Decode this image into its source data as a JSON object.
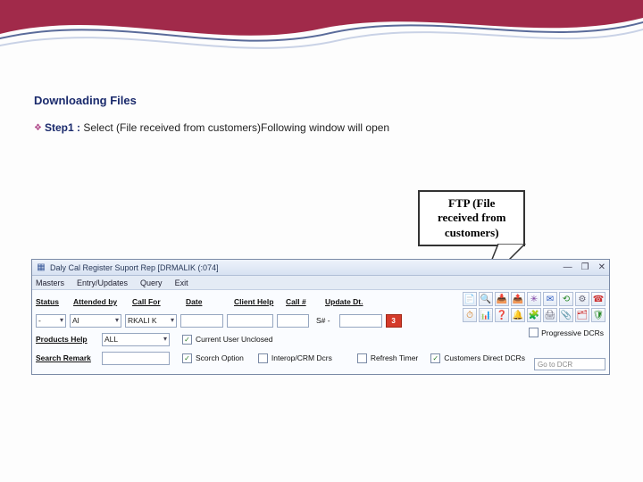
{
  "slide": {
    "title": "Downloading Files",
    "step_label": "Step1 :",
    "step_text": " Select (File received from customers)Following window will open"
  },
  "callout": {
    "line1": "FTP (File",
    "line2": "received from",
    "line3": "customers)"
  },
  "app": {
    "title": "Daly Cal Register  Suport Rep [DRMALIK (:074]",
    "menu": {
      "m1": "Masters",
      "m2": "Entry/Updates",
      "m3": "Query",
      "m4": "Exit"
    },
    "winbtns": {
      "min": "—",
      "max": "❐",
      "close": "✕"
    },
    "labels": {
      "status": "Status",
      "attended": "Attended by",
      "callfor": "Call For",
      "date": "Date",
      "clienthelp": "Client Help",
      "call": "Call #",
      "updatedt": "Update Dt.",
      "products": "Products Help",
      "search": "Search Remark"
    },
    "values": {
      "status_v": "-",
      "attended_v": "Al",
      "callfor_v": "RKALI K",
      "date_v": "",
      "call_v": "",
      "srno": "S# -",
      "products_v": "ALL"
    },
    "redbtn": "3",
    "checks": {
      "currentuser": "Current User Unclosed",
      "scrch": "Scorch Option",
      "interop": "Interop/CRM Dcrs",
      "refresh": "Refresh Timer",
      "custdirect": "Customers Direct DCRs",
      "progressive": "Progressive DCRs"
    },
    "goto_placeholder": "Go to DCR"
  },
  "icons": {
    "t1": "📄",
    "t2": "🔍",
    "t3": "📥",
    "t4": "📤",
    "t5": "✳",
    "t6": "✉",
    "t7": "⟲",
    "t8": "⚙",
    "t9": "☎",
    "t10": "⏱",
    "t11": "📊",
    "t12": "❓",
    "t13": "🔔",
    "t14": "🧩",
    "t15": "🖨",
    "t16": "📎",
    "t17": "🗂",
    "t18": "🛡"
  }
}
